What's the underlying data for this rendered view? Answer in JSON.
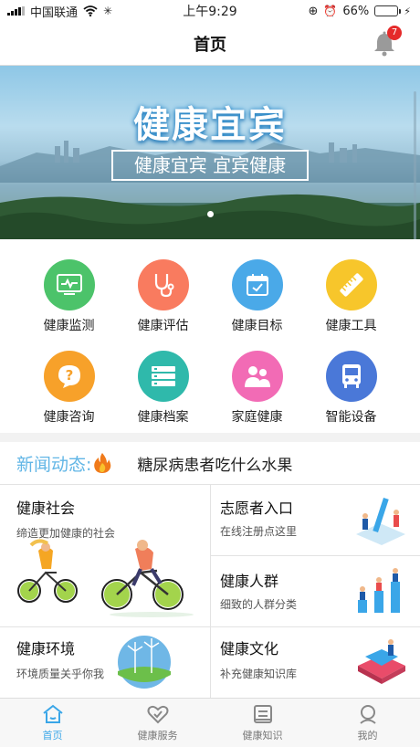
{
  "status_bar": {
    "carrier": "中国联通",
    "time": "上午9:29",
    "battery_percent": "66%",
    "battery_level": 0.66
  },
  "nav": {
    "title": "首页",
    "notification_count": "7"
  },
  "banner": {
    "title": "健康宜宾",
    "subtitle": "健康宜宾 宜宾健康"
  },
  "grid": [
    {
      "label": "健康监测",
      "icon": "monitor-icon",
      "color": "#4cc36a"
    },
    {
      "label": "健康评估",
      "icon": "stethoscope-icon",
      "color": "#f97b5f"
    },
    {
      "label": "健康目标",
      "icon": "calendar-icon",
      "color": "#4aa9e8"
    },
    {
      "label": "健康工具",
      "icon": "ruler-icon",
      "color": "#f7c62b"
    },
    {
      "label": "健康咨询",
      "icon": "question-bubble-icon",
      "color": "#f7a12a"
    },
    {
      "label": "健康档案",
      "icon": "list-icon",
      "color": "#2fb9ab"
    },
    {
      "label": "家庭健康",
      "icon": "family-icon",
      "color": "#f26bb5"
    },
    {
      "label": "智能设备",
      "icon": "device-icon",
      "color": "#4a78d8"
    }
  ],
  "news": {
    "label": "新闻动态:",
    "headline": "糖尿病患者吃什么水果"
  },
  "cards": {
    "social": {
      "title": "健康社会",
      "subtitle": "缔造更加健康的社会"
    },
    "volunteer": {
      "title": "志愿者入口",
      "subtitle": "在线注册点这里"
    },
    "crowd": {
      "title": "健康人群",
      "subtitle": "细致的人群分类"
    },
    "environment": {
      "title": "健康环境",
      "subtitle": "环境质量关乎你我"
    },
    "culture": {
      "title": "健康文化",
      "subtitle": "补充健康知识库"
    }
  },
  "tabs": [
    {
      "label": "首页",
      "icon": "home-icon",
      "active": true
    },
    {
      "label": "健康服务",
      "icon": "heart-icon",
      "active": false
    },
    {
      "label": "健康知识",
      "icon": "book-icon",
      "active": false
    },
    {
      "label": "我的",
      "icon": "profile-icon",
      "active": false
    }
  ],
  "colors": {
    "accent": "#3aa6e8",
    "news_label": "#62b6e6",
    "badge": "#e52a2a"
  }
}
